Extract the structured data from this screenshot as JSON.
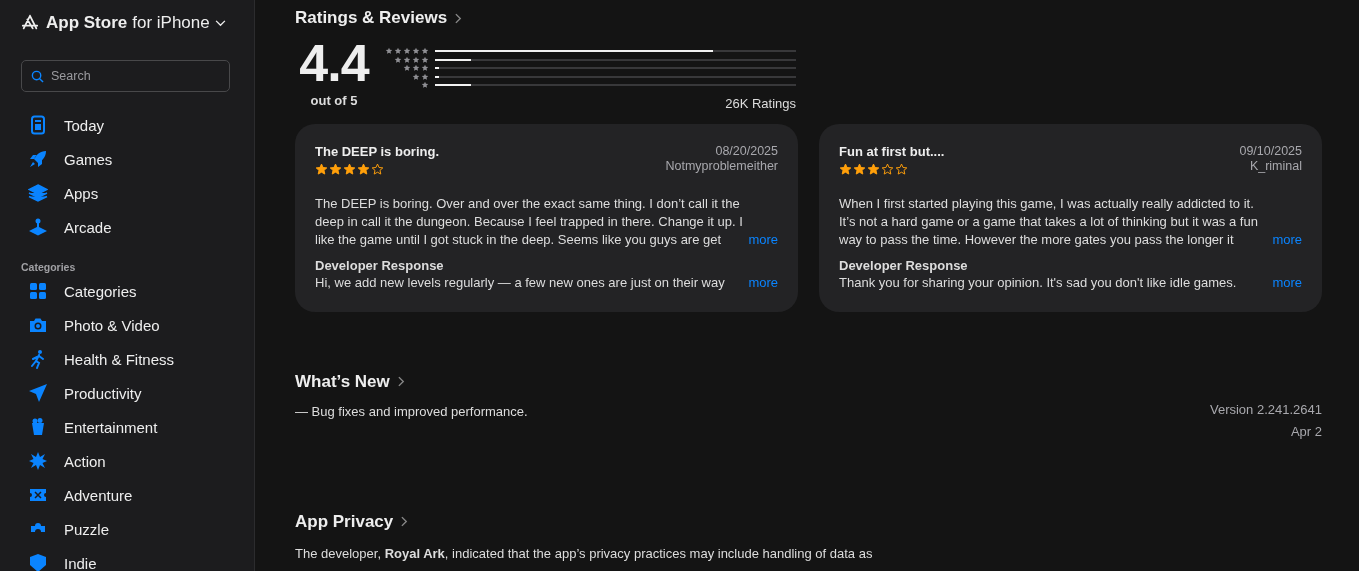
{
  "sidebar": {
    "title": "App Store",
    "subtitle": "for iPhone",
    "search": {
      "placeholder": "Search"
    },
    "nav": [
      {
        "label": "Today",
        "kind": "today"
      },
      {
        "label": "Games",
        "kind": "rocket"
      },
      {
        "label": "Apps",
        "kind": "layers"
      },
      {
        "label": "Arcade",
        "kind": "joystick"
      }
    ],
    "categories_heading": "Categories",
    "categories": [
      {
        "label": "Categories",
        "kind": "grid"
      },
      {
        "label": "Photo & Video",
        "kind": "camera"
      },
      {
        "label": "Health & Fitness",
        "kind": "runner"
      },
      {
        "label": "Productivity",
        "kind": "plane"
      },
      {
        "label": "Entertainment",
        "kind": "popcorn"
      },
      {
        "label": "Action",
        "kind": "burst"
      },
      {
        "label": "Adventure",
        "kind": "ticket"
      },
      {
        "label": "Puzzle",
        "kind": "puzzle"
      },
      {
        "label": "Indie",
        "kind": "shield"
      }
    ]
  },
  "ratings": {
    "heading": "Ratings & Reviews",
    "score": "4.4",
    "out_of": "out of 5",
    "histogram": [
      {
        "level": 0.77
      },
      {
        "level": 0.1
      },
      {
        "level": 0.01
      },
      {
        "level": 0.01
      },
      {
        "level": 0.1
      }
    ],
    "count": "26K Ratings"
  },
  "reviews": [
    {
      "title": "The DEEP is boring.",
      "stars": 4,
      "date": "08/20/2025",
      "author": "Notmyproblemeither",
      "body": "The DEEP is boring. Over and over the exact same thing. I don’t call it the deep in call it the dungeon. Because I feel trapped in there. Change it up. I like the game until I got stuck in the deep. Seems like you guys are get",
      "more": "more",
      "response_heading": "Developer Response",
      "response": "Hi, we add new levels regularly — a few new ones are just on their way",
      "response_more": "more"
    },
    {
      "title": "Fun at first but....",
      "stars": 3,
      "date": "09/10/2025",
      "author": "K_riminal",
      "body": "When I first started playing this game, I was actually really addicted to it. It’s not a hard game or a game that takes a lot of thinking but it was a fun way to pass the time. However the more gates you pass the longer it",
      "more": "more",
      "response_heading": "Developer Response",
      "response": "Thank you for sharing your opinion. It's sad you don't like idle games.",
      "response_more": "more"
    }
  ],
  "whats_new": {
    "heading": "What’s New",
    "notes": "— Bug fixes and improved performance.",
    "version": "Version 2.241.2641",
    "date": "Apr 2"
  },
  "privacy": {
    "heading": "App Privacy",
    "text": "The developer, **Royal Ark**, indicated that the app’s privacy practices may include handling of data as"
  }
}
